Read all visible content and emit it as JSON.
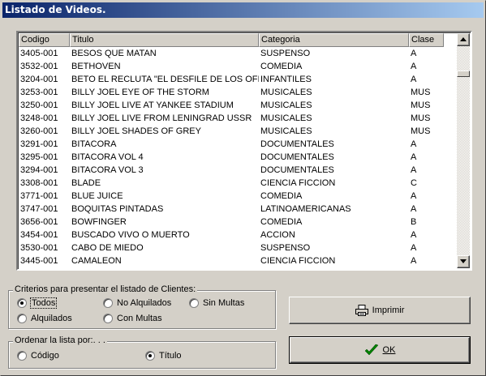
{
  "window": {
    "title": "Listado de Videos."
  },
  "list": {
    "columns": [
      "Codigo",
      "Titulo",
      "Categoria",
      "Clase"
    ],
    "rows": [
      [
        "3405-001",
        "BESOS QUE MATAN",
        "SUSPENSO",
        "A"
      ],
      [
        "3532-001",
        "BETHOVEN",
        "COMEDIA",
        "A"
      ],
      [
        "3204-001",
        "BETO EL RECLUTA \"EL DESFILE DE LOS OFICI",
        "INFANTILES",
        "A"
      ],
      [
        "3253-001",
        "BILLY JOEL EYE OF THE STORM",
        "MUSICALES",
        "MUS"
      ],
      [
        "3250-001",
        "BILLY JOEL LIVE AT YANKEE STADIUM",
        "MUSICALES",
        "MUS"
      ],
      [
        "3248-001",
        "BILLY JOEL LIVE FROM LENINGRAD USSR",
        "MUSICALES",
        "MUS"
      ],
      [
        "3260-001",
        "BILLY JOEL SHADES OF GREY",
        "MUSICALES",
        "MUS"
      ],
      [
        "3291-001",
        "BITACORA",
        "DOCUMENTALES",
        "A"
      ],
      [
        "3295-001",
        "BITACORA VOL 4",
        "DOCUMENTALES",
        "A"
      ],
      [
        "3294-001",
        "BITACORA VOL 3",
        "DOCUMENTALES",
        "A"
      ],
      [
        "3308-001",
        "BLADE",
        "CIENCIA FICCION",
        "C"
      ],
      [
        "3771-001",
        "BLUE JUICE",
        "COMEDIA",
        "A"
      ],
      [
        "3747-001",
        "BOQUITAS PINTADAS",
        "LATINOAMERICANAS",
        "A"
      ],
      [
        "3656-001",
        "BOWFINGER",
        "COMEDIA",
        "B"
      ],
      [
        "3454-001",
        "BUSCADO VIVO O MUERTO",
        "ACCION",
        "A"
      ],
      [
        "3530-001",
        "CABO DE MIEDO",
        "SUSPENSO",
        "A"
      ],
      [
        "3445-001",
        "CAMALEON",
        "CIENCIA FICCION",
        "A"
      ]
    ]
  },
  "criteria": {
    "label": "Criterios para presentar el listado de Clientes:",
    "options": {
      "todos": {
        "label": "Todos",
        "checked": true
      },
      "no_alquilados": {
        "label": "No Alquilados",
        "checked": false
      },
      "sin_multas": {
        "label": "Sin Multas",
        "checked": false
      },
      "alquilados": {
        "label": "Alquilados",
        "checked": false
      },
      "con_multas": {
        "label": "Con Multas",
        "checked": false
      }
    }
  },
  "order": {
    "label": "Ordenar la lista por:. . .",
    "options": {
      "codigo": {
        "label": "Código",
        "checked": false
      },
      "titulo": {
        "label": "Título",
        "checked": true
      }
    }
  },
  "buttons": {
    "print": {
      "label": "Imprimir",
      "icon": "printer-icon"
    },
    "ok": {
      "label": "OK",
      "icon": "checkmark-icon",
      "accent": "#008000"
    }
  }
}
